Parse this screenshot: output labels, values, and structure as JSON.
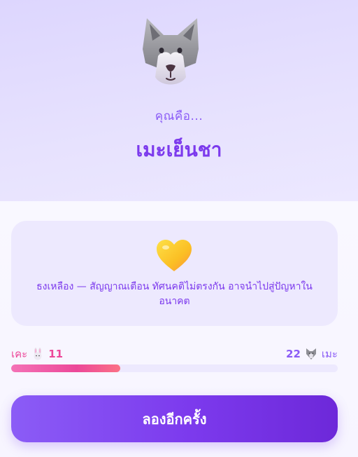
{
  "hero": {
    "avatar_icon": "wolf-face-icon",
    "intro": "คุณคือ...",
    "result": "เมะเย็นชา"
  },
  "verdict": {
    "icon": "yellow-heart-icon",
    "text": "ธงเหลือง — สัญญาณเตือน ทัศนคติไม่ตรงกัน อาจนำไปสู่ปัญหาในอนาคต"
  },
  "scores": {
    "left": {
      "name": "เคะ",
      "icon": "rabbit-icon",
      "value": "11"
    },
    "right": {
      "name": "เมะ",
      "icon": "wolf-icon",
      "value": "22"
    },
    "left_share": 0.333,
    "colors": {
      "left": "#ec4899",
      "right": "#8b5cf6",
      "track": "#ede9fe"
    }
  },
  "retry_label": "ลองอีกครั้ง",
  "colors": {
    "accent": "#7c3aed",
    "hero_bg": "#ddd6fe",
    "panel_bg": "#ede9fe"
  }
}
